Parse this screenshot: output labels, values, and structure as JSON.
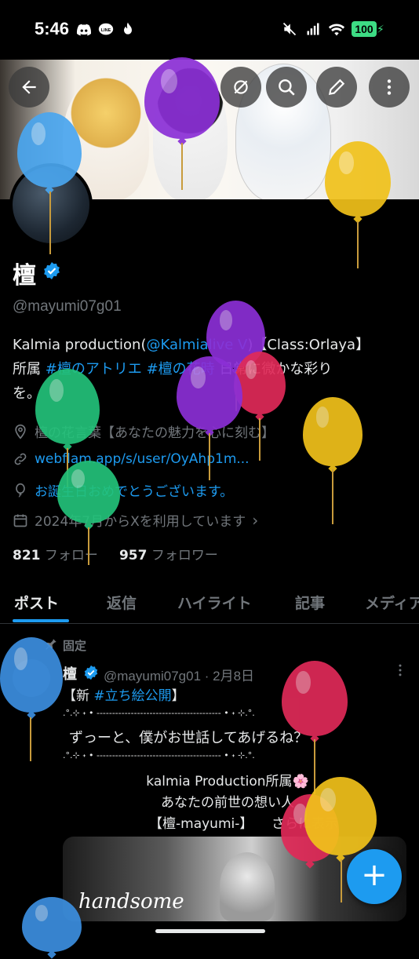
{
  "status_bar": {
    "time": "5:46",
    "battery": "100"
  },
  "profile": {
    "name": "檀",
    "handle": "@mayumi07g01",
    "bio": {
      "part1": "Kalmia production(",
      "mention": "@Kalmialive V",
      "part2": ")【Class:Orlaya】",
      "line2_a": "所属 ",
      "hashtag1": "#檀のアトリエ",
      "line2_b": " ",
      "hashtag2": "#檀の花時",
      "line2_c": " 日常に微かな彩り",
      "line3": "を。"
    },
    "location": "檀の花言葉【あなたの魅力を心に刻む】",
    "website": "webflam.app/s/user/OyAhp1m...",
    "birthday": "お誕生日おめでとうございます。",
    "joined": "2024年7月からXを利用しています",
    "following_count": "821",
    "following_label": "フォロー",
    "followers_count": "957",
    "followers_label": "フォロワー"
  },
  "tabs": [
    {
      "label": "ポスト"
    },
    {
      "label": "返信"
    },
    {
      "label": "ハイライト"
    },
    {
      "label": "記事"
    },
    {
      "label": "メディア"
    }
  ],
  "post": {
    "pinned_label": "固定",
    "author_name": "檀",
    "author_handle": "@mayumi07g01 · 2月8日",
    "line1_a": "【新 ",
    "line1_tag": "#立ち絵公開",
    "line1_b": "】",
    "deco1": ".°.⊹ ˖ • ---------------------------------------- • ˖ ⊹.°.",
    "quote": "ずっーと、僕がお世話してあげるね？",
    "deco2": ".°.⊹ ˖ • ---------------------------------------- • ˖ ⊹.°.",
    "line_kalmia": "kalmia Production所属🌸",
    "line_past": "あなたの前世の想い人",
    "line_name": "【檀-mayumi-】",
    "show_more": "さらに表示",
    "image_text": "handsome"
  },
  "colors": {
    "accent": "#1d9bf0",
    "background": "#000000",
    "text_primary": "#e7e9ea",
    "text_secondary": "#71767b"
  }
}
